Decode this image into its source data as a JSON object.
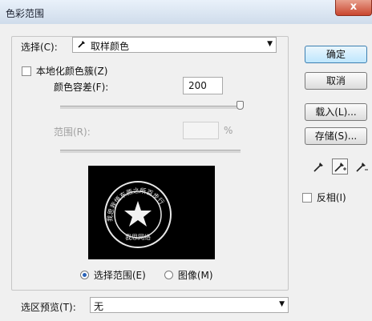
{
  "window": {
    "title": "色彩范围",
    "close_label": "x"
  },
  "select": {
    "label": "选择(C):",
    "value": "取样颜色",
    "icon": "eyedropper-icon"
  },
  "localized_clusters": {
    "label": "本地化颜色簇(Z)",
    "checked": false
  },
  "fuzziness": {
    "label": "颜色容差(F):",
    "value": "200"
  },
  "range": {
    "label": "范围(R):",
    "value": "",
    "unit": "%"
  },
  "preview_image": {
    "seal_top_text": "我思我悟东西之所百步行",
    "seal_bottom_text": "我思网络"
  },
  "view_mode": {
    "selection_label": "选择范围(E)",
    "image_label": "图像(M)",
    "selected": "selection"
  },
  "selection_preview": {
    "label": "选区预览(T):",
    "value": "无"
  },
  "buttons": {
    "ok": "确定",
    "cancel": "取消",
    "load": "载入(L)...",
    "save": "存储(S)..."
  },
  "invert": {
    "label": "反相(I)",
    "checked": false
  },
  "droppers": [
    "eyedropper-icon",
    "eyedropper-plus-icon",
    "eyedropper-minus-icon"
  ]
}
